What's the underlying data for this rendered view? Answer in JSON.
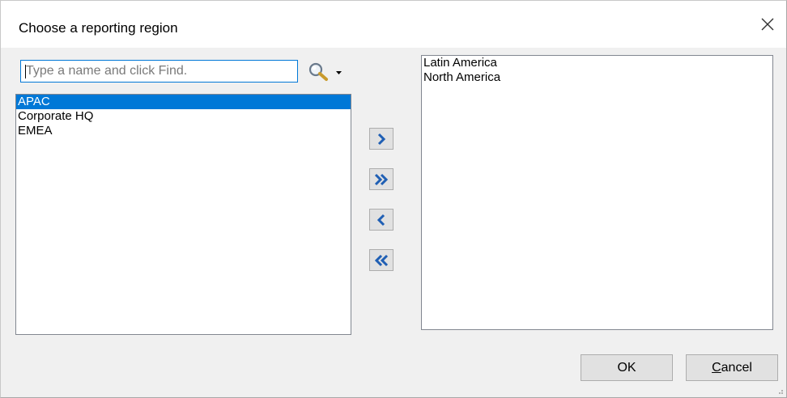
{
  "dialog": {
    "title": "Choose a reporting region",
    "close_icon": "close-icon"
  },
  "search": {
    "placeholder": "Type a name and click Find.",
    "value": "",
    "find_icon": "magnifier-icon",
    "menu_icon": "dropdown-arrow-icon"
  },
  "available": {
    "items": [
      {
        "label": "APAC",
        "selected": true
      },
      {
        "label": "Corporate HQ",
        "selected": false
      },
      {
        "label": "EMEA",
        "selected": false
      }
    ]
  },
  "selected_list": {
    "items": [
      {
        "label": "Latin America"
      },
      {
        "label": "North America"
      }
    ]
  },
  "move_buttons": {
    "add_icon": "chevron-right-icon",
    "add_all_icon": "double-chevron-right-icon",
    "remove_icon": "chevron-left-icon",
    "remove_all_icon": "double-chevron-left-icon"
  },
  "buttons": {
    "ok_label": "OK",
    "cancel_accel": "C",
    "cancel_rest": "ancel"
  },
  "colors": {
    "selection": "#0078d7",
    "button_face": "#e1e1e1",
    "arrow_blue": "#1f5fb4"
  }
}
